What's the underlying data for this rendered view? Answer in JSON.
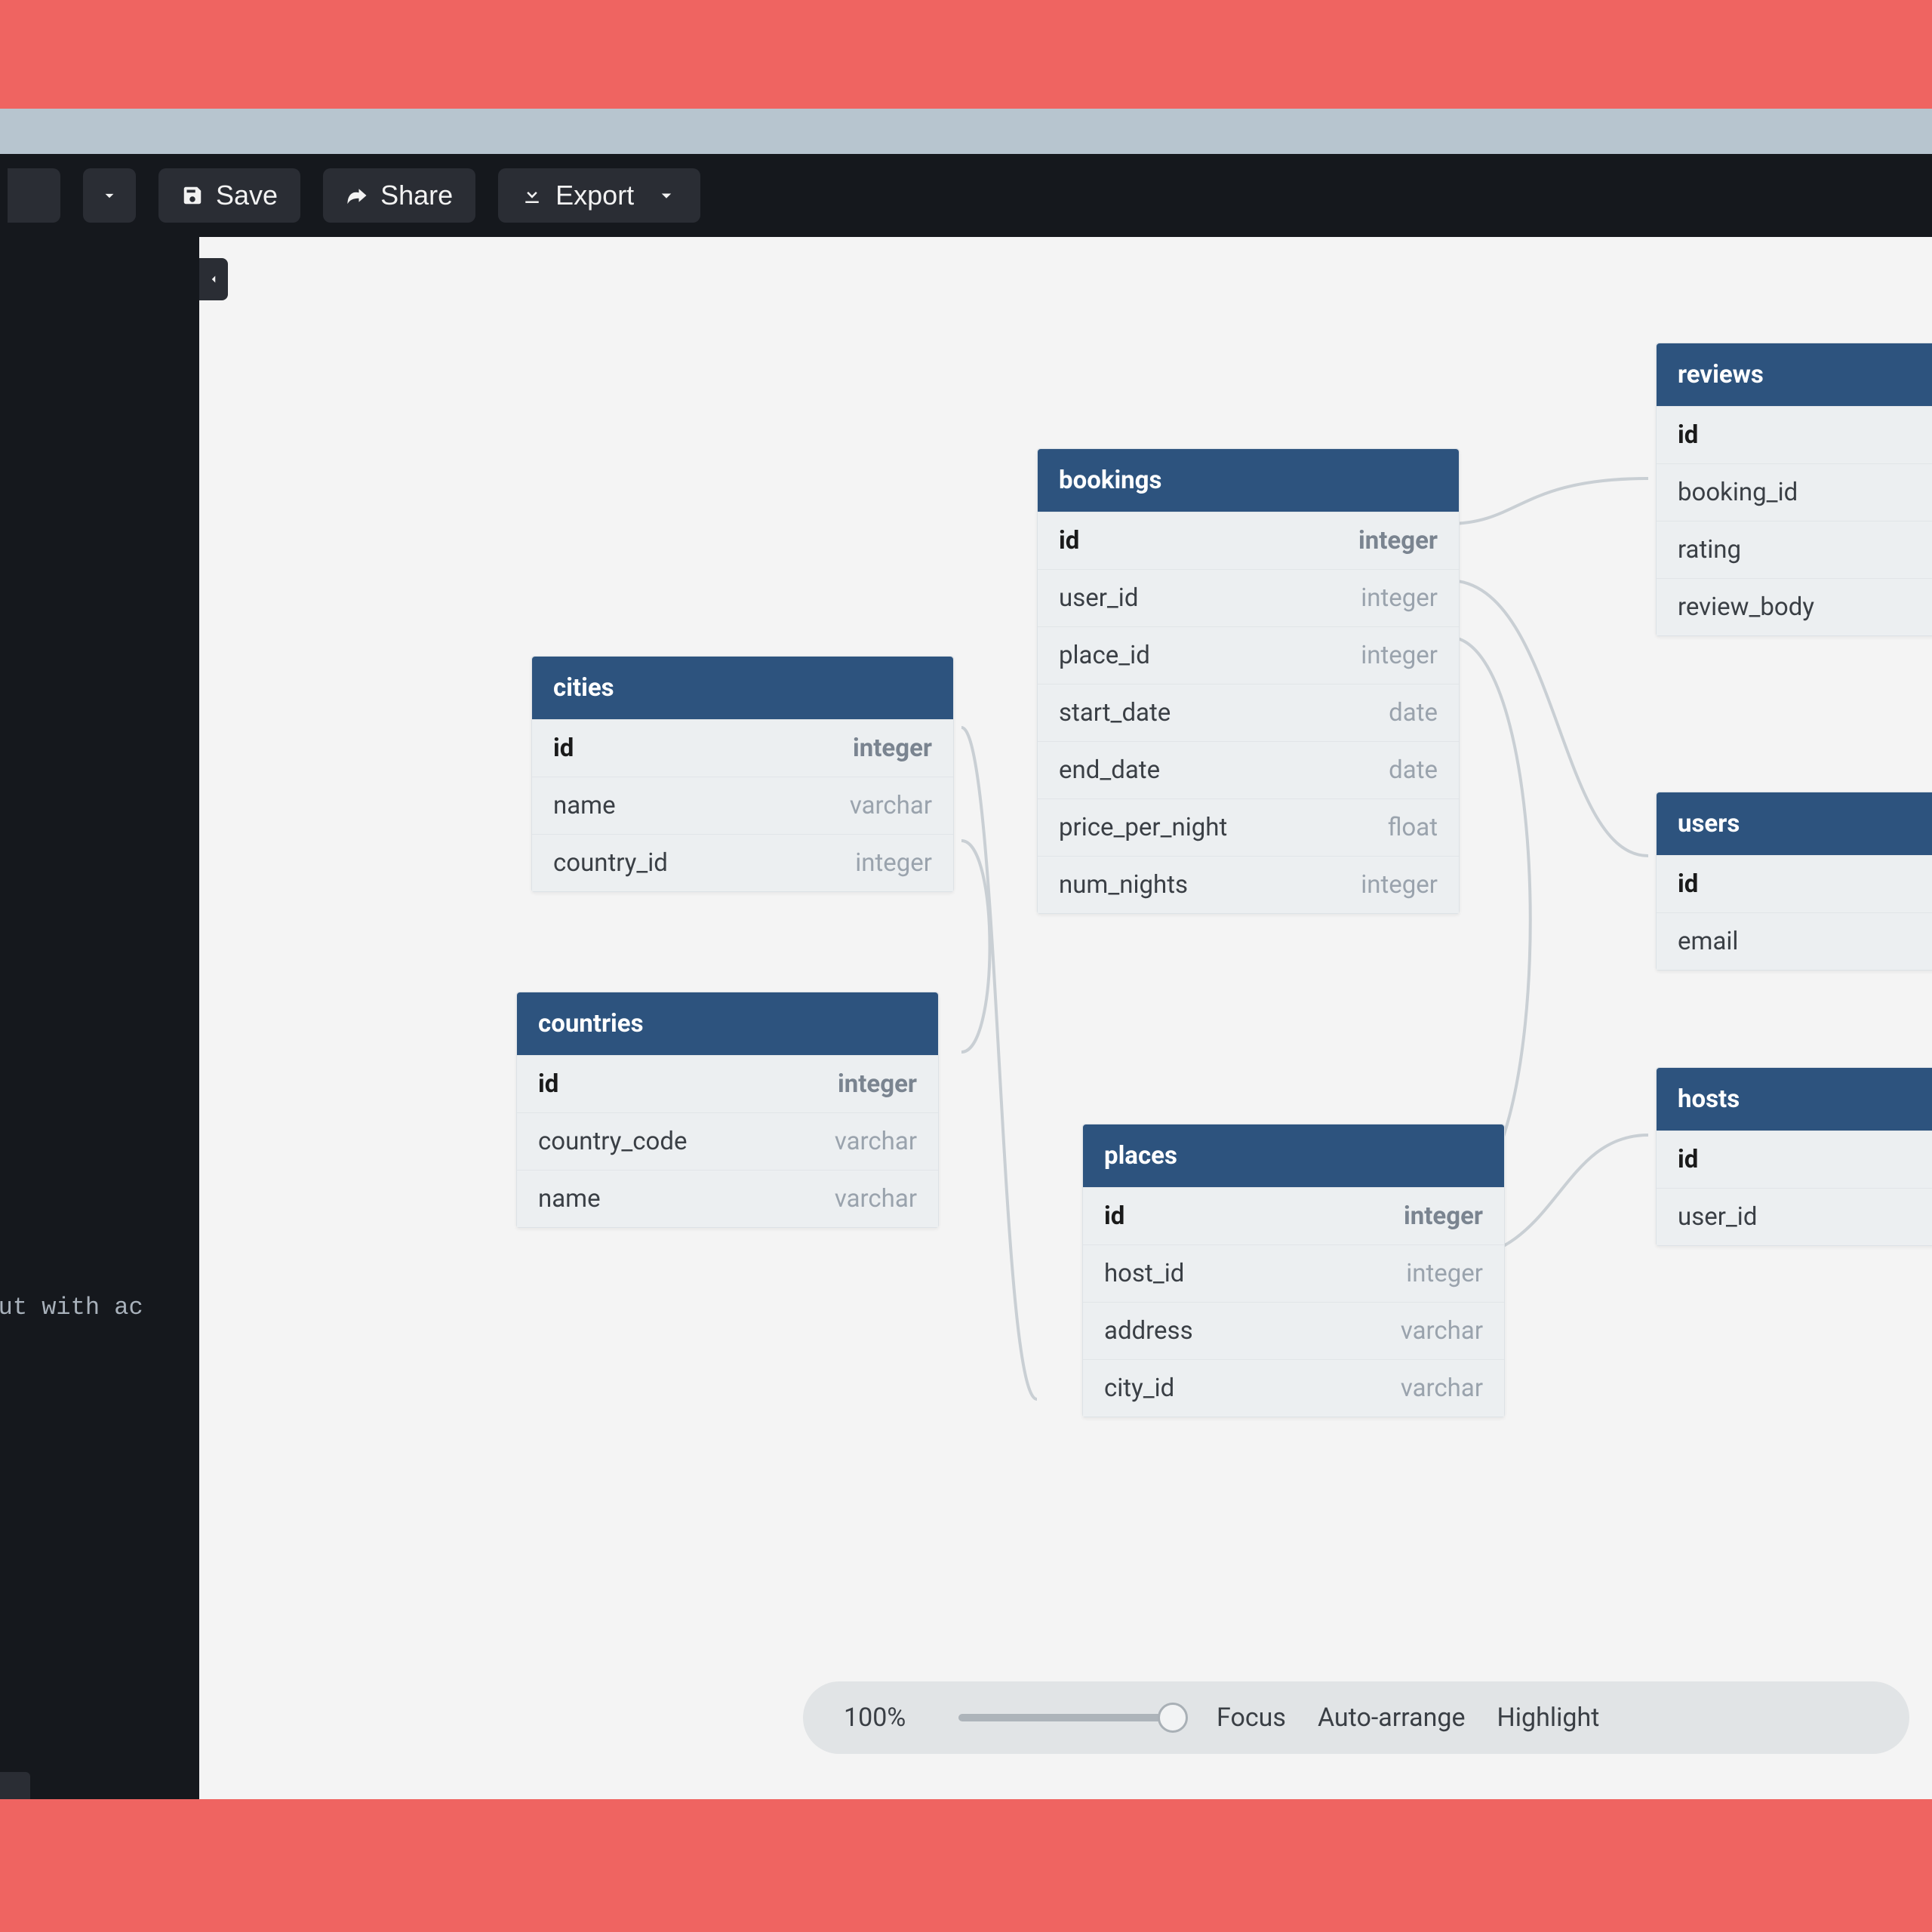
{
  "toolbar": {
    "save_label": "Save",
    "share_label": "Share",
    "export_label": "Export"
  },
  "sidebar": {
    "code_fragment": ", but with ac"
  },
  "tables": {
    "cities": {
      "name": "cities",
      "fields": [
        {
          "name": "id",
          "type": "integer",
          "pk": true
        },
        {
          "name": "name",
          "type": "varchar"
        },
        {
          "name": "country_id",
          "type": "integer"
        }
      ]
    },
    "countries": {
      "name": "countries",
      "fields": [
        {
          "name": "id",
          "type": "integer",
          "pk": true
        },
        {
          "name": "country_code",
          "type": "varchar"
        },
        {
          "name": "name",
          "type": "varchar"
        }
      ]
    },
    "bookings": {
      "name": "bookings",
      "fields": [
        {
          "name": "id",
          "type": "integer",
          "pk": true
        },
        {
          "name": "user_id",
          "type": "integer"
        },
        {
          "name": "place_id",
          "type": "integer"
        },
        {
          "name": "start_date",
          "type": "date"
        },
        {
          "name": "end_date",
          "type": "date"
        },
        {
          "name": "price_per_night",
          "type": "float"
        },
        {
          "name": "num_nights",
          "type": "integer"
        }
      ]
    },
    "places": {
      "name": "places",
      "fields": [
        {
          "name": "id",
          "type": "integer",
          "pk": true
        },
        {
          "name": "host_id",
          "type": "integer"
        },
        {
          "name": "address",
          "type": "varchar"
        },
        {
          "name": "city_id",
          "type": "varchar"
        }
      ]
    },
    "reviews": {
      "name": "reviews",
      "fields": [
        {
          "name": "id",
          "pk": true
        },
        {
          "name": "booking_id"
        },
        {
          "name": "rating"
        },
        {
          "name": "review_body"
        }
      ]
    },
    "users": {
      "name": "users",
      "fields": [
        {
          "name": "id",
          "pk": true
        },
        {
          "name": "email"
        }
      ]
    },
    "hosts": {
      "name": "hosts",
      "fields": [
        {
          "name": "id",
          "pk": true
        },
        {
          "name": "user_id"
        }
      ]
    }
  },
  "footer": {
    "zoom": "100%",
    "focus": "Focus",
    "auto_arrange": "Auto-arrange",
    "highlight": "Highlight"
  }
}
